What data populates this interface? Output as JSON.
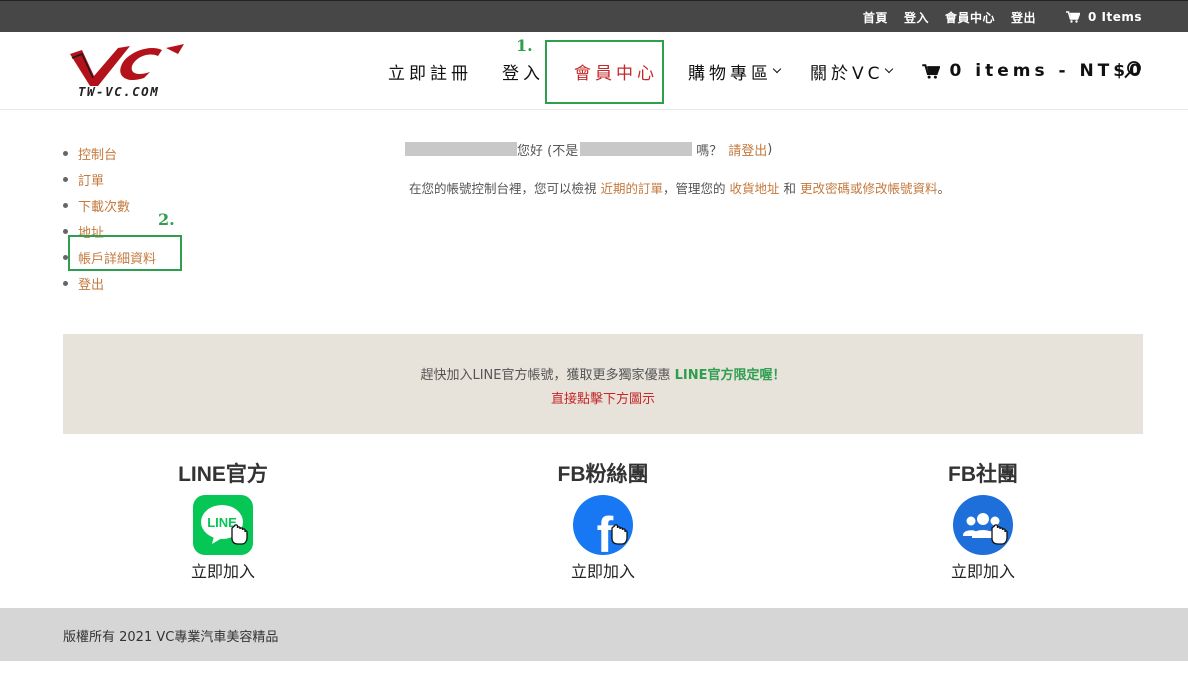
{
  "topbar": {
    "links": [
      "首頁",
      "登入",
      "會員中心",
      "登出"
    ],
    "cart": "0 Items"
  },
  "header": {
    "logo_text": "TW-VC.COM",
    "nav": [
      {
        "label": "立即註冊"
      },
      {
        "label": "登入"
      },
      {
        "label": "會員中心",
        "active": true
      },
      {
        "label": "購物專區"
      },
      {
        "label": "關於VC"
      }
    ],
    "cart": "0 items - NT$0"
  },
  "annotations": {
    "step1": "1.",
    "step2": "2."
  },
  "sidebar": {
    "items": [
      "控制台",
      "訂單",
      "下載次數",
      "地址",
      "帳戶詳細資料",
      "登出"
    ]
  },
  "main": {
    "greeting_hello": "您好 (不是",
    "greeting_question": "嗎？",
    "logout_link": "請登出",
    "greeting_close": ")",
    "desc_pre": "在您的帳號控制台裡，您可以檢視 ",
    "desc_link1": "近期的訂單",
    "desc_mid1": "，管理您的 ",
    "desc_link2": "收貨地址",
    "desc_mid2": " 和 ",
    "desc_link3": "更改密碼或修改帳號資料",
    "desc_end": "。"
  },
  "banner": {
    "line1_pre": "趕快加入LINE官方帳號，獲取更多獨家優惠 ",
    "line1_green": "LINE官方限定喔！",
    "line2": "直接點擊下方圖示"
  },
  "social": [
    {
      "title": "LINE官方",
      "join": "立即加入",
      "icon_label": "LINE"
    },
    {
      "title": "FB粉絲團",
      "join": "立即加入",
      "icon_label": "f"
    },
    {
      "title": "FB社團",
      "join": "立即加入"
    }
  ],
  "footer": {
    "copyright": "版權所有 2021 VC專業汽車美容精品"
  },
  "colors": {
    "accent": "#c47a3e",
    "active": "#c62828",
    "annotation": "#2e9e4f",
    "line_green": "#06c755",
    "fb_blue": "#1877f2"
  }
}
